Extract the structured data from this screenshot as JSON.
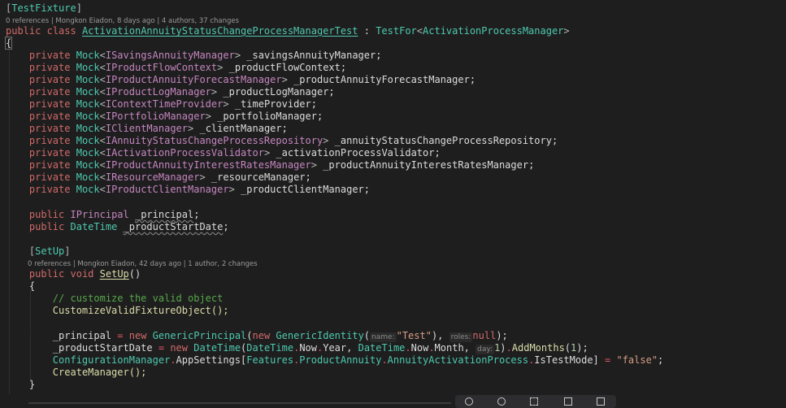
{
  "lens": {
    "class_refs": "0 references | Mongkon Eiadon, 8 days ago | 4 authors, 37 changes",
    "setup_refs": "0 references | Mongkon Eiadon, 42 days ago | 1 author, 2 changes"
  },
  "code": {
    "attr_testfixture": "TestFixture",
    "kw_public": "public",
    "kw_class": "class",
    "class_name": "ActivationAnnuityStatusChangeProcessManagerTest",
    "colon": " : ",
    "base_testfor": "TestFor",
    "base_generic": "ActivationProcessManager",
    "open_brace": "{",
    "close_brace": "}",
    "kw_private": "private",
    "mock": "Mock",
    "fields": [
      {
        "iface": "ISavingsAnnuityManager",
        "name": "_savingsAnnuityManager;"
      },
      {
        "iface": "IProductFlowContext",
        "name": "_productFlowContext;"
      },
      {
        "iface": "IProductAnnuityForecastManager",
        "name": "_productAnnuityForecastManager;"
      },
      {
        "iface": "IProductLogManager",
        "name": "_productLogManager;"
      },
      {
        "iface": "IContextTimeProvider",
        "name": "_timeProvider;"
      },
      {
        "iface": "IPortfolioManager",
        "name": "_portfolioManager;"
      },
      {
        "iface": "IClientManager",
        "name": "_clientManager;"
      },
      {
        "iface": "IAnnuityStatusChangeProcessRepository",
        "name": "_annuityStatusChangeProcessRepository;"
      },
      {
        "iface": "IActivationProcessValidator",
        "name": "_activationProcessValidator;"
      },
      {
        "iface": "IProductAnnuityInterestRatesManager",
        "name": "_productAnnuityInterestRatesManager;"
      },
      {
        "iface": "IResourceManager",
        "name": "_resourceManager;"
      },
      {
        "iface": "IProductClientManager",
        "name": "_productClientManager;"
      }
    ],
    "iprincipal": "IPrincipal",
    "principal_field": "_principal",
    "datetime": "DateTime",
    "startdate_field": "_productStartDate",
    "attr_setup": "SetUp",
    "kw_void": "void",
    "method_setup": "SetUp",
    "parens": "()",
    "comment": "// customize the valid object",
    "call_customize": "CustomizeValidFixtureObject();",
    "assign_principal": "_principal",
    "kw_new": "new",
    "generic_principal": "GenericPrincipal",
    "generic_identity": "GenericIdentity",
    "hint_name": "name:",
    "str_test": "\"Test\"",
    "hint_roles": "roles:",
    "kw_null": "null",
    "assign_startdate": "_productStartDate",
    "now": "Now",
    "year": "Year",
    "month": "Month",
    "hint_day": "day:",
    "num_1": "1",
    "add_months": "AddMonths",
    "config_manager": "ConfigurationManager",
    "app_settings": "AppSettings",
    "features": "Features",
    "product_annuity": "ProductAnnuity",
    "activation_process": "AnnuityActivationProcess",
    "is_test_mode": "IsTestMode",
    "str_false": "\"false\"",
    "create_manager": "CreateManager();"
  },
  "icons": [
    "search-icon",
    "search-icon-2",
    "expand-icon",
    "window-icon",
    "panel-icon"
  ]
}
